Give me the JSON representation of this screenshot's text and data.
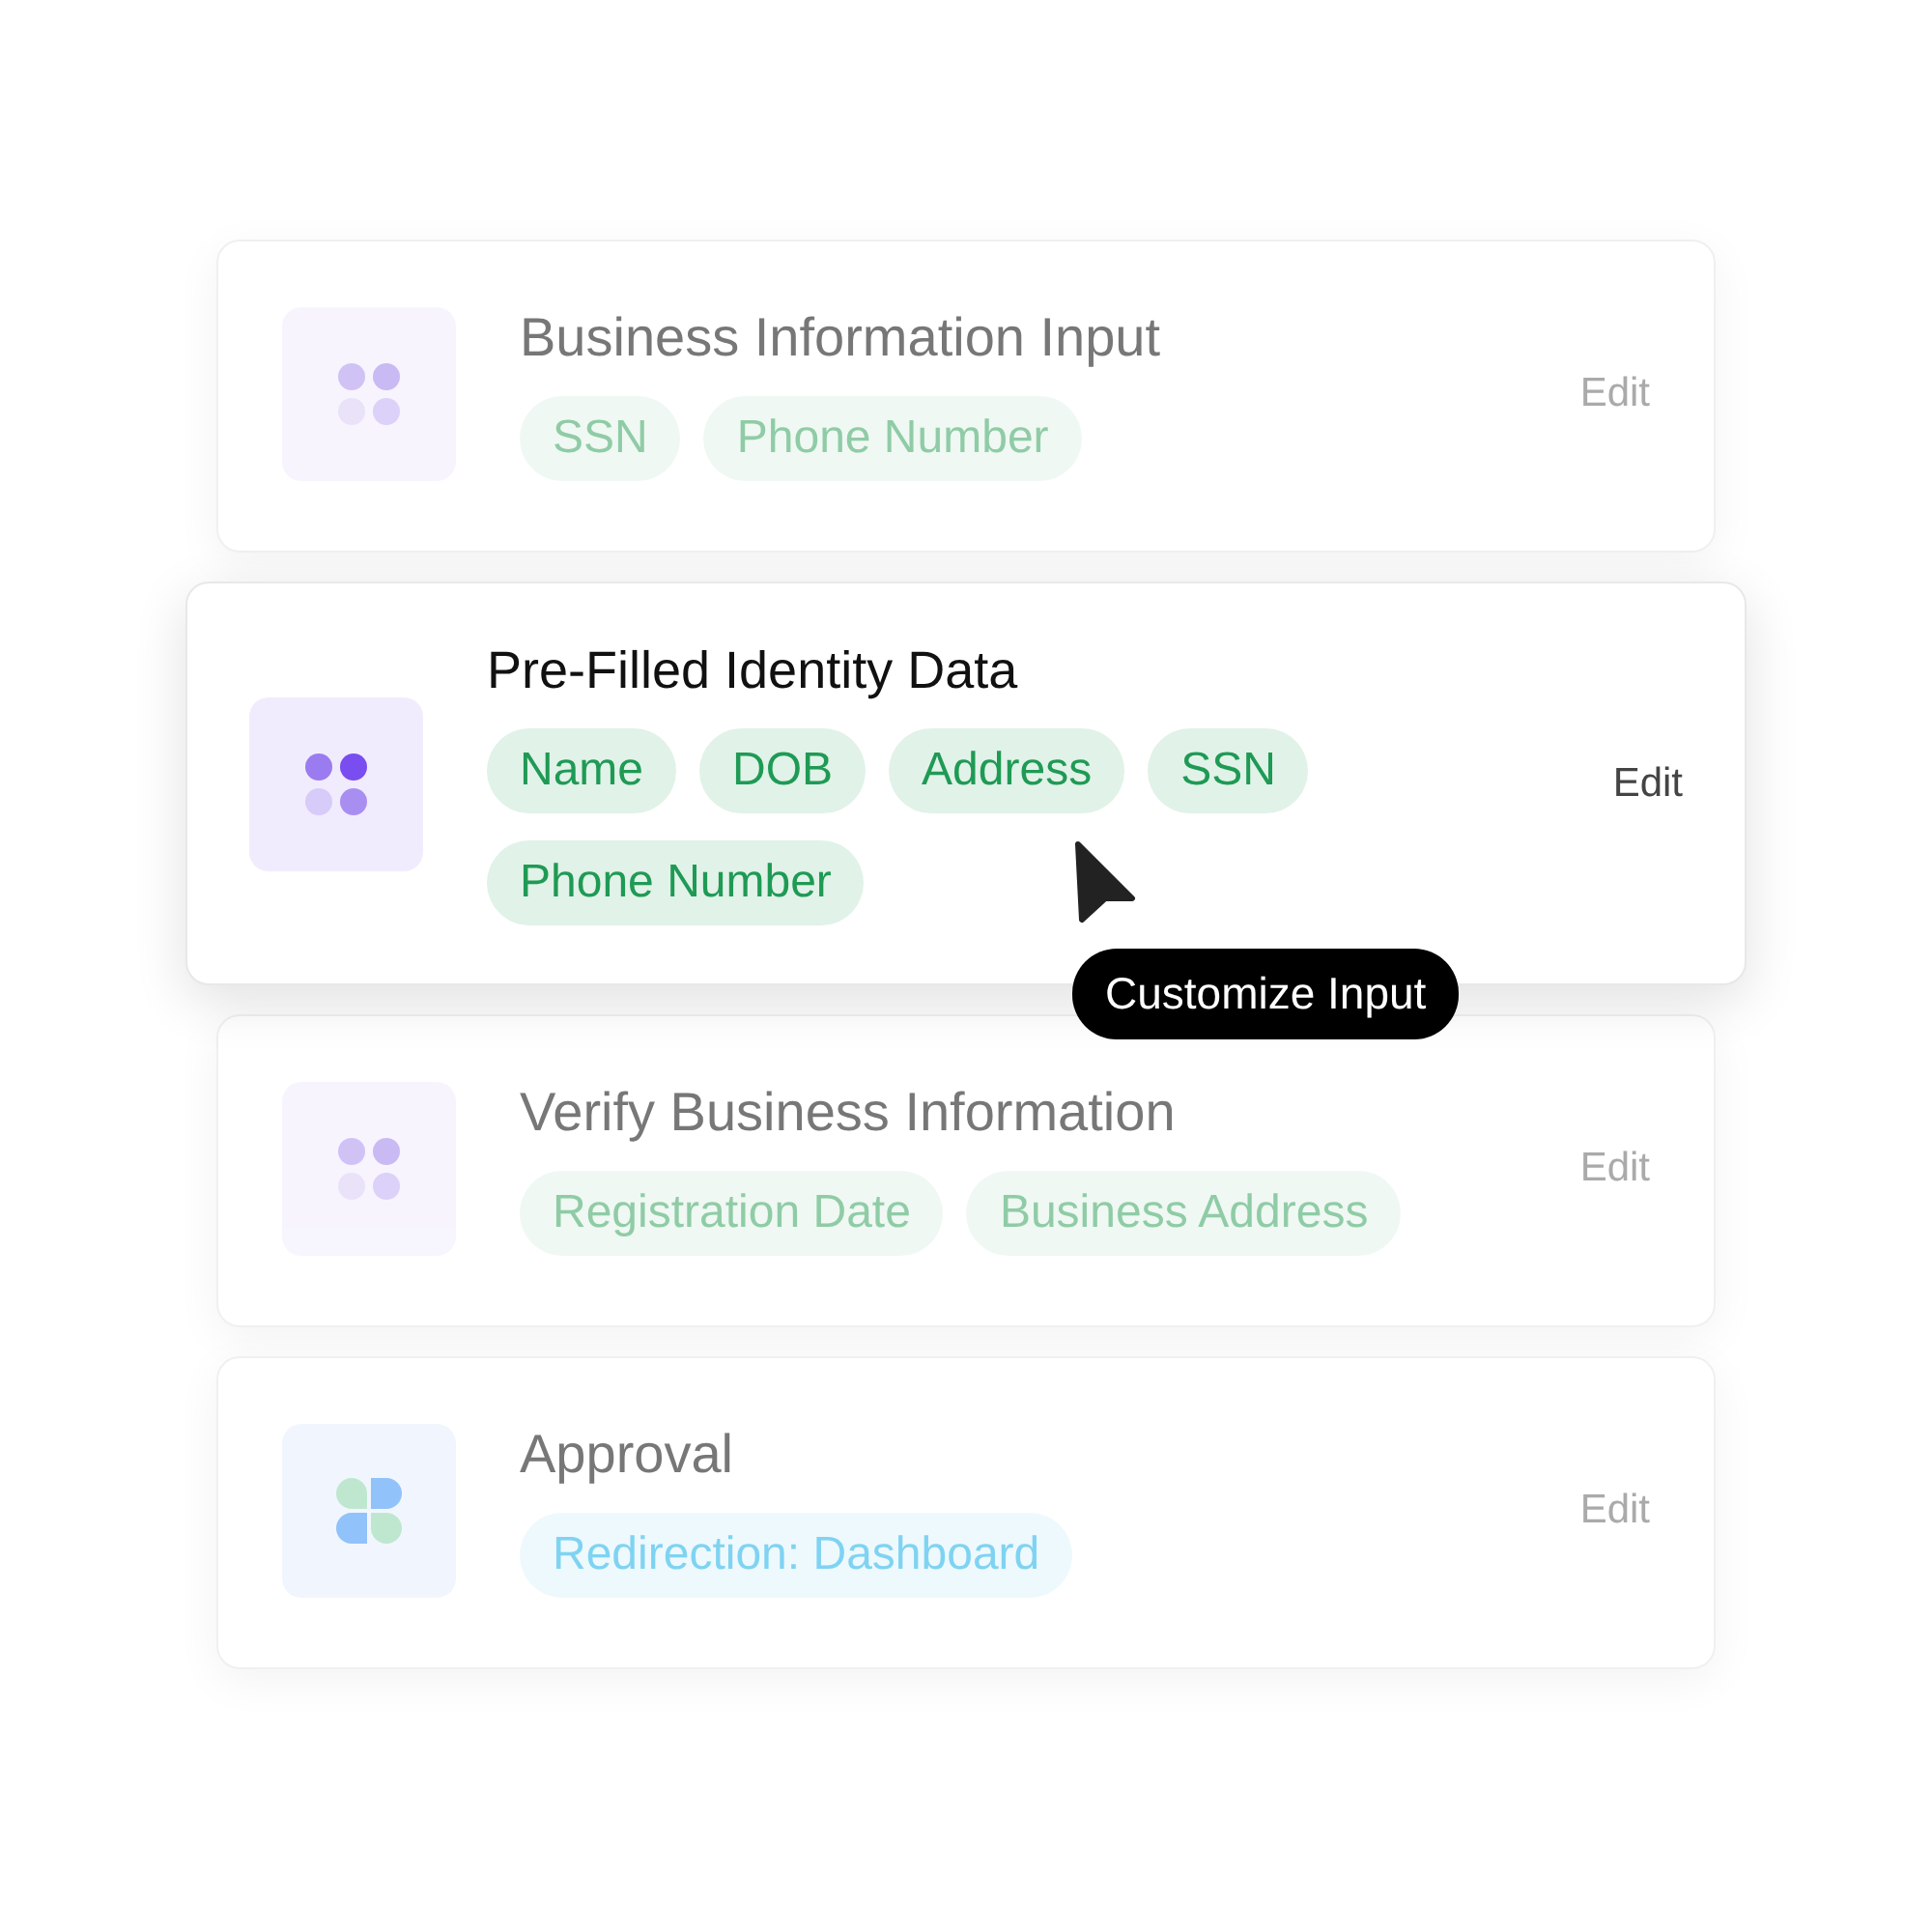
{
  "steps": [
    {
      "title": "Business Information Input",
      "selected": false,
      "kind": "dots",
      "tags": [
        {
          "label": "SSN",
          "color": "#8fcca6"
        },
        {
          "label": "Phone Number",
          "color": "#8fcca6"
        }
      ],
      "action": "Edit"
    },
    {
      "title": "Pre-Filled Identity Data",
      "selected": true,
      "kind": "dots",
      "tags": [
        {
          "label": "Name",
          "color": "#1f9a55"
        },
        {
          "label": "DOB",
          "color": "#1f9a55"
        },
        {
          "label": "Address",
          "color": "#1f9a55"
        },
        {
          "label": "SSN",
          "color": "#1f9a55"
        },
        {
          "label": "Phone Number",
          "color": "#1f9a55"
        }
      ],
      "action": "Edit",
      "tooltip": "Customize Input"
    },
    {
      "title": "Verify Business Information",
      "selected": false,
      "kind": "dots",
      "tags": [
        {
          "label": "Registration Date",
          "color": "#8fcca6"
        },
        {
          "label": "Business Address",
          "color": "#8fcca6"
        }
      ],
      "action": "Edit"
    },
    {
      "title": "Approval",
      "selected": false,
      "kind": "petals",
      "tags": [
        {
          "label": "Redirection: Dashboard",
          "color": "#7fd3f2"
        }
      ],
      "action": "Edit"
    }
  ]
}
